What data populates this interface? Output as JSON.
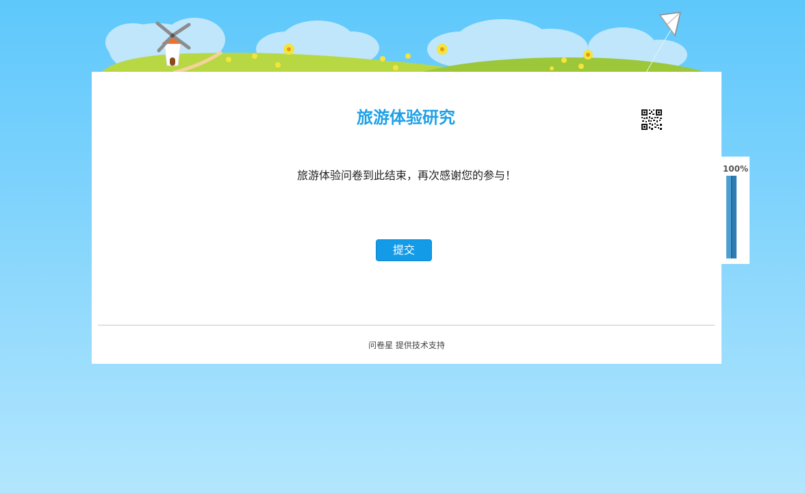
{
  "survey": {
    "title": "旅游体验研究",
    "message": "旅游体验问卷到此结束，再次感谢您的参与！",
    "submit_label": "提交"
  },
  "footer": {
    "brand": "问卷星",
    "support_text": "提供技术支持"
  },
  "progress": {
    "label": "100%",
    "value": 1.0
  },
  "icons": {
    "qr": "qr-code-icon",
    "windmill": "windmill-icon",
    "kite": "kite-icon"
  },
  "colors": {
    "title": "#1ea0e6",
    "button": "#139be8",
    "sky": "#5ec8fb",
    "grass": "#a9d23a"
  }
}
